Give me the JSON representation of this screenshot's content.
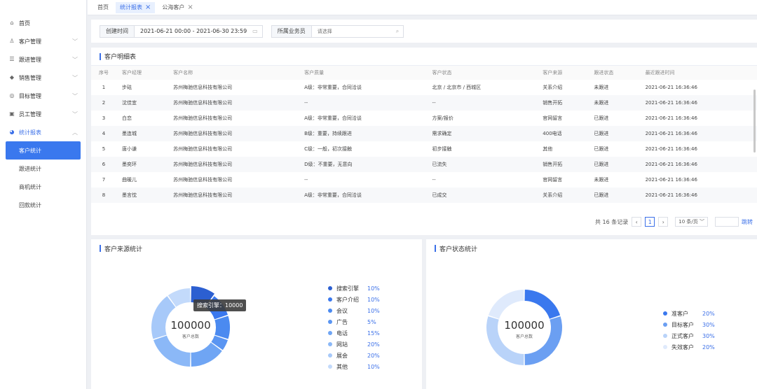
{
  "sidebar": {
    "items": [
      {
        "label": "首页",
        "icon": "home-icon",
        "glyph": "⌂",
        "has_arrow": false
      },
      {
        "label": "客户管理",
        "icon": "user-icon",
        "glyph": "♙",
        "has_arrow": true
      },
      {
        "label": "跟进管理",
        "icon": "follow-icon",
        "glyph": "☰",
        "has_arrow": true
      },
      {
        "label": "销售管理",
        "icon": "diamond-icon",
        "glyph": "◆",
        "has_arrow": true
      },
      {
        "label": "目标管理",
        "icon": "target-icon",
        "glyph": "◎",
        "has_arrow": true
      },
      {
        "label": "员工管理",
        "icon": "card-icon",
        "glyph": "▣",
        "has_arrow": true
      },
      {
        "label": "统计报表",
        "icon": "pie-icon",
        "glyph": "◕",
        "has_arrow": true,
        "expanded": true
      }
    ],
    "sub_items": [
      "客户统计",
      "跟进统计",
      "商机统计",
      "回款统计"
    ],
    "active_sub": 0,
    "arrow_down": "﹀",
    "arrow_up": "︿"
  },
  "tabs": [
    {
      "label": "首页",
      "closable": false,
      "active": false
    },
    {
      "label": "统计报表",
      "closable": true,
      "active": true
    },
    {
      "label": "公海客户",
      "closable": true,
      "active": false
    }
  ],
  "filters": {
    "created_label": "创建时间",
    "created_value": "2021-06-21 00:00 - 2021-06-30 23:59",
    "salesman_label": "所属业务员",
    "salesman_placeholder": "请选择"
  },
  "table": {
    "title": "客户明细表",
    "columns": [
      "序号",
      "客户经理",
      "客户名称",
      "客户质量",
      "客户状态",
      "客户来源",
      "跟进状态",
      "最近跟进时间"
    ],
    "rows": [
      [
        "1",
        "步砝",
        "苏州梅驰信息科技有限公司",
        "A级：非常重要，合同洽谈",
        "北京 / 北京市 / 西城区",
        "关系介绍",
        "未跟进",
        "2021-06-21 16:36:46"
      ],
      [
        "2",
        "沈佳宜",
        "苏州梅驰信息科技有限公司",
        "--",
        "--",
        "销售开拓",
        "未跟进",
        "2021-06-21 16:36:46"
      ],
      [
        "3",
        "白恋",
        "苏州梅驰信息科技有限公司",
        "A级：非常重要，合同洽谈",
        "方案/报价",
        "官网留言",
        "已跟进",
        "2021-06-21 16:36:46"
      ],
      [
        "4",
        "墨连城",
        "苏州梅驰信息科技有限公司",
        "B级：重要，持续跟进",
        "需求确定",
        "400电话",
        "已跟进",
        "2021-06-21 16:36:46"
      ],
      [
        "5",
        "唐小谦",
        "苏州梅驰信息科技有限公司",
        "C级：一般，初次接触",
        "初步接触",
        "其他",
        "已跟进",
        "2021-06-21 16:36:46"
      ],
      [
        "6",
        "墨奕环",
        "苏州梅驰信息科技有限公司",
        "D级：不重要，无意向",
        "已流失",
        "销售开拓",
        "已跟进",
        "2021-06-21 16:36:46"
      ],
      [
        "7",
        "曲暖儿",
        "苏州梅驰信息科技有限公司",
        "--",
        "--",
        "官网留言",
        "未跟进",
        "2021-06-21 16:36:46"
      ],
      [
        "8",
        "墨言忱",
        "苏州梅驰信息科技有限公司",
        "A级：非常重要，合同洽谈",
        "已成交",
        "关系介绍",
        "已跟进",
        "2021-06-21 16:36:46"
      ]
    ]
  },
  "pagination": {
    "total_text": "共 16 条记录",
    "prev": "‹",
    "current": "1",
    "next": "›",
    "page_size": "10 条/页 ﹀",
    "jump_label": "跳转"
  },
  "source_chart": {
    "title": "客户来源统计",
    "total": "100000",
    "total_label": "客户总数",
    "tooltip": "搜索引擎：10000",
    "items": [
      {
        "label": "搜索引擎",
        "value": "10%",
        "pct": 10,
        "color": "#2c5fd1"
      },
      {
        "label": "客户介绍",
        "value": "10%",
        "pct": 10,
        "color": "#3a78ee"
      },
      {
        "label": "会议",
        "value": "10%",
        "pct": 10,
        "color": "#4b8af0"
      },
      {
        "label": "广告",
        "value": "5%",
        "pct": 5,
        "color": "#5a95f2"
      },
      {
        "label": "电话",
        "value": "15%",
        "pct": 15,
        "color": "#6fa5f4"
      },
      {
        "label": "网站",
        "value": "20%",
        "pct": 20,
        "color": "#8bb8f7"
      },
      {
        "label": "展会",
        "value": "20%",
        "pct": 20,
        "color": "#a7c9f9"
      },
      {
        "label": "其他",
        "value": "10%",
        "pct": 10,
        "color": "#c3dafb"
      }
    ]
  },
  "status_chart": {
    "title": "客户状态统计",
    "total": "100000",
    "total_label": "客户总数",
    "items": [
      {
        "label": "准客户",
        "value": "20%",
        "pct": 20,
        "color": "#3a78ee"
      },
      {
        "label": "目标客户",
        "value": "30%",
        "pct": 30,
        "color": "#6b9ff2"
      },
      {
        "label": "正式客户",
        "value": "30%",
        "pct": 30,
        "color": "#b9d3f9"
      },
      {
        "label": "失效客户",
        "value": "20%",
        "pct": 20,
        "color": "#dfeafc"
      }
    ]
  }
}
